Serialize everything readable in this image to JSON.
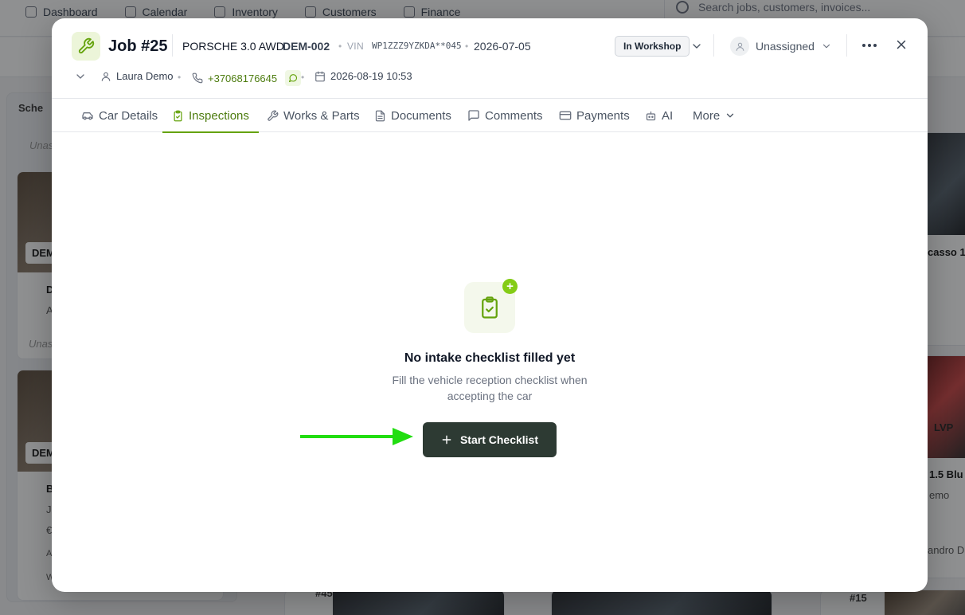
{
  "background": {
    "nav": [
      {
        "label": "Dashboard"
      },
      {
        "label": "Calendar"
      },
      {
        "label": "Inventory"
      },
      {
        "label": "Customers"
      },
      {
        "label": "Finance"
      }
    ],
    "search_placeholder": "Search jobs, customers, invoices...",
    "fragments": {
      "col1_header": "Sche",
      "unassigned_1": "Unas",
      "unassigned_2": "Unas",
      "card1_tag": "DEM",
      "card2_tag": "DEM",
      "card1_line1": "D",
      "card1_line2": "A",
      "card2_line1": "B",
      "card2_line2": "Ja",
      "card2_line3": "€",
      "card2_line4": "A",
      "card2_line5": "W",
      "card_bottom_1": "#45",
      "card_bottom_2": "#15",
      "right_car_1": "casso 1.",
      "right_car_2": "1.5 Blu",
      "right_person": "emo",
      "right_bottom": "andro D",
      "plate_fragment": "LVP"
    }
  },
  "job": {
    "title": "Job #25",
    "car_model": "PORSCHE 3.0 AWD",
    "plate": "DEM-002",
    "vin_label": "VIN",
    "vin": "WP1ZZZ9YZKDA**045",
    "date": "2026-07-05",
    "status": "In Workshop",
    "assignee": "Unassigned",
    "customer": "Laura Demo",
    "phone": "+37068176645",
    "created_at": "2026-08-19 10:53"
  },
  "tabs": [
    {
      "label": "Car Details",
      "icon": "car-icon"
    },
    {
      "label": "Inspections",
      "icon": "clipboard-check-icon",
      "active": true
    },
    {
      "label": "Works & Parts",
      "icon": "wrench-icon"
    },
    {
      "label": "Documents",
      "icon": "document-icon"
    },
    {
      "label": "Comments",
      "icon": "comment-icon"
    },
    {
      "label": "Payments",
      "icon": "credit-card-icon"
    },
    {
      "label": "AI",
      "icon": "robot-icon"
    },
    {
      "label": "More",
      "icon": "chevron-down-icon"
    }
  ],
  "empty_state": {
    "title": "No intake checklist filled yet",
    "description": "Fill the vehicle reception checklist when accepting the car",
    "button_label": "Start Checklist",
    "plus_badge": "+"
  },
  "colors": {
    "accent": "#65a30d",
    "accent_text": "#4d7c0f",
    "button_dark": "#2d3a33",
    "arrow": "#22dd11"
  }
}
